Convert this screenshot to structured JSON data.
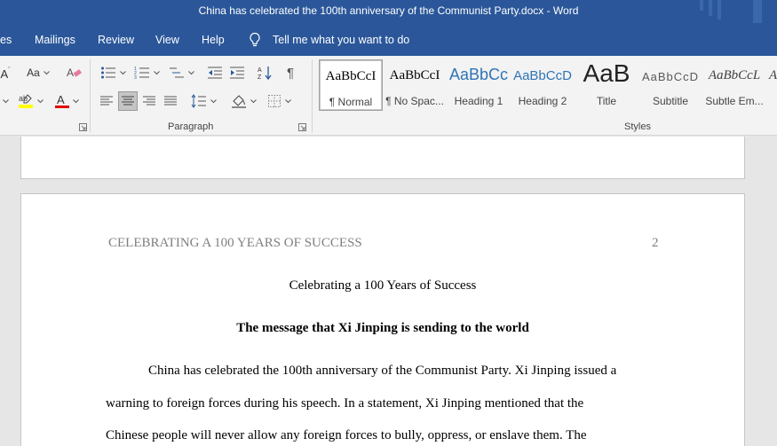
{
  "window": {
    "title": "China has celebrated the 100th anniversary of the Communist Party.docx  -  Word"
  },
  "tabs": [
    {
      "label": "es"
    },
    {
      "label": "Mailings"
    },
    {
      "label": "Review"
    },
    {
      "label": "View"
    },
    {
      "label": "Help"
    }
  ],
  "tell_me": {
    "text": "Tell me what you want to do"
  },
  "ribbon": {
    "font_group": {
      "change_case_label": "Aa"
    },
    "paragraph_group": {
      "label": "Paragraph"
    },
    "styles_group": {
      "label": "Styles",
      "styles": [
        {
          "preview": "AaBbCcI",
          "name": "¶ Normal",
          "selected": true
        },
        {
          "preview": "AaBbCcI",
          "name": "¶ No Spac..."
        },
        {
          "preview": "AaBbCc",
          "name": "Heading 1"
        },
        {
          "preview": "AaBbCcD",
          "name": "Heading 2"
        },
        {
          "preview": "AaB",
          "name": "Title"
        },
        {
          "preview": "AaBbCcD",
          "name": "Subtitle"
        },
        {
          "preview": "AaBbCcL",
          "name": "Subtle Em..."
        },
        {
          "preview": "A"
        }
      ]
    },
    "colors": {
      "highlight": "#ffff00",
      "font_color": "#e00000",
      "accent": "#2b579a"
    }
  },
  "document": {
    "running_head": "CELEBRATING A 100 YEARS OF SUCCESS",
    "page_number": "2",
    "title": "Celebrating a 100 Years of Success",
    "subtitle": "The message that Xi Jinping is sending to the world",
    "lines": [
      "China has celebrated the 100th anniversary of the Communist Party. Xi Jinping issued a",
      "warning to foreign forces during his speech. In a statement, Xi Jinping mentioned that the",
      "Chinese people will never allow any foreign forces to bully, oppress, or enslave them. The"
    ]
  }
}
